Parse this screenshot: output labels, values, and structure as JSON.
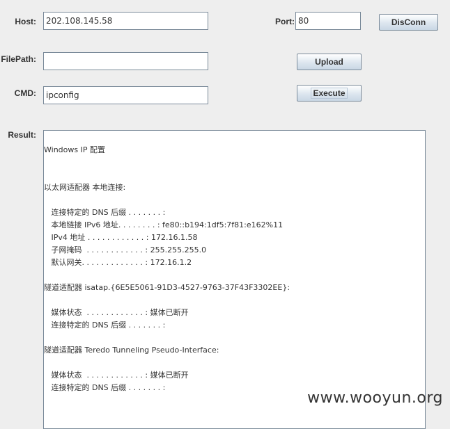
{
  "host": {
    "label": "Host:",
    "value": "202.108.145.58"
  },
  "port": {
    "label": "Port:",
    "value": "80"
  },
  "filepath": {
    "label": "FilePath:",
    "value": ""
  },
  "cmd": {
    "label": "CMD:",
    "value": "ipconfig"
  },
  "buttons": {
    "disconnect": "DisConn",
    "upload": "Upload",
    "execute": "Execute"
  },
  "result": {
    "label": "Result:",
    "lines": [
      "Windows IP 配置",
      "",
      "",
      "以太网适配器 本地连接:",
      "",
      "   连接特定的 DNS 后缀 . . . . . . . :",
      "   本地链接 IPv6 地址. . . . . . . . : fe80::b194:1df5:7f81:e162%11",
      "   IPv4 地址 . . . . . . . . . . . . : 172.16.1.58",
      "   子网掩码  . . . . . . . . . . . . : 255.255.255.0",
      "   默认网关. . . . . . . . . . . . . : 172.16.1.2",
      "",
      "隧道适配器 isatap.{6E5E5061-91D3-4527-9763-37F43F3302EE}:",
      "",
      "   媒体状态  . . . . . . . . . . . . : 媒体已断开",
      "   连接特定的 DNS 后缀 . . . . . . . :",
      "",
      "隧道适配器 Teredo Tunneling Pseudo-Interface:",
      "",
      "   媒体状态  . . . . . . . . . . . . : 媒体已断开",
      "   连接特定的 DNS 后缀 . . . . . . . :"
    ]
  },
  "watermark": "www.wooyun.org"
}
